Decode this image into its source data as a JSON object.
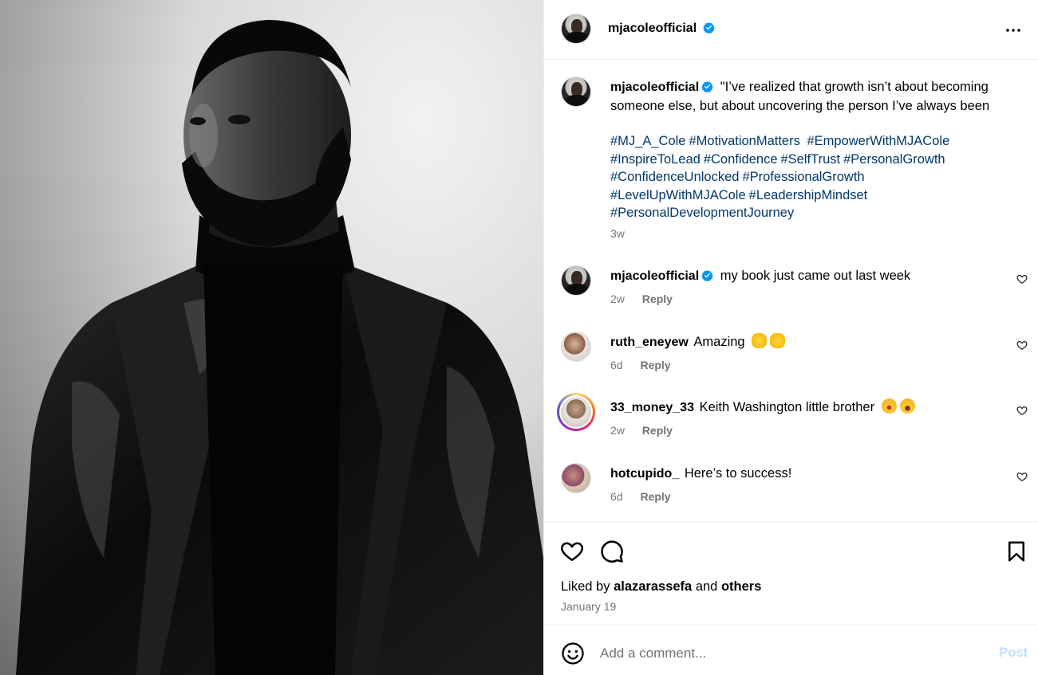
{
  "post": {
    "username": "mjacoleofficial",
    "more_icon": "more-horizontal-icon",
    "caption": {
      "username": "mjacoleofficial",
      "text": "\"I’ve realized that growth isn’t about becoming someone else, but about uncovering the person I’ve always been",
      "hashtags": [
        "#MJ_A_Cole",
        "#MotivationMatters",
        " #EmpowerWithMJACole",
        "#InspireToLead",
        "#Confidence",
        "#SelfTrust",
        "#PersonalGrowth",
        "#ConfidenceUnlocked",
        "#ProfessionalGrowth",
        "#LevelUpWithMJACole",
        "#LeadershipMindset",
        "#PersonalDevelopmentJourney"
      ],
      "time": "3w"
    },
    "comments": [
      {
        "username": "mjacoleofficial",
        "text": "my book just came out last week",
        "time": "2w",
        "reply": "Reply",
        "verified": true
      },
      {
        "username": "ruth_eneyew",
        "text": "Amazing",
        "time": "6d",
        "reply": "Reply",
        "emojis": [
          "clapping-hands",
          "clapping-hands"
        ]
      },
      {
        "username": "33_money_33",
        "text": "Keith Washington little brother",
        "time": "2w",
        "reply": "Reply",
        "emojis": [
          "astonished-face",
          "laughing-face"
        ]
      },
      {
        "username": "hotcupido_",
        "text": "Here’s to success!",
        "time": "6d",
        "reply": "Reply"
      }
    ],
    "likes": {
      "prefix": "Liked by",
      "user": "alazarassefa",
      "and": "and",
      "others": "others"
    },
    "date": "January 19",
    "add_comment": {
      "placeholder": "Add a comment...",
      "post_label": "Post"
    }
  },
  "colors": {
    "hashtag": "#00376b",
    "secondary_text": "#737373",
    "verified": "#0095f6",
    "post_disabled": "#c0dffd"
  }
}
